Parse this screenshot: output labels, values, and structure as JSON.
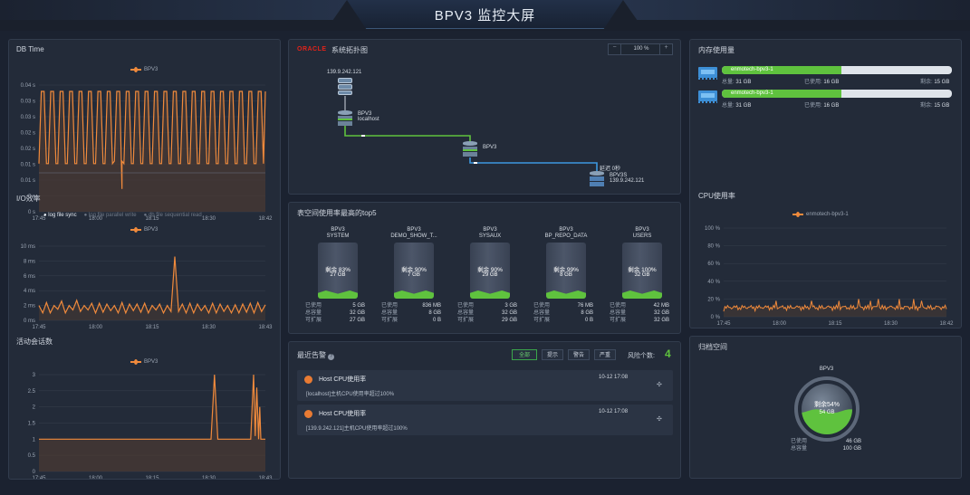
{
  "header": {
    "title": "BPV3 监控大屏"
  },
  "db_time": {
    "title": "DB Time",
    "legend": "BPV3",
    "y_ticks": [
      "0.04 s",
      "0.03 s",
      "0.03 s",
      "0.02 s",
      "0.02 s",
      "0.01 s",
      "0.01 s",
      "0 s",
      "0 s"
    ],
    "x_ticks": [
      "17:45",
      "18:00",
      "18:15",
      "18:30",
      "18:42"
    ]
  },
  "io": {
    "title": "I/O效率",
    "options": [
      "log file sync",
      "log file parallel write",
      "db file sequential read"
    ],
    "legend": "BPV3",
    "y_ticks": [
      "10 ms",
      "8 ms",
      "6 ms",
      "4 ms",
      "2 ms",
      "0 ms"
    ],
    "x_ticks": [
      "17:45",
      "18:00",
      "18:15",
      "18:30",
      "18:43"
    ]
  },
  "sessions": {
    "title": "活动会话数",
    "legend": "BPV3",
    "y_ticks": [
      "3",
      "2.5",
      "2",
      "1.5",
      "1",
      "0.5",
      "0"
    ],
    "x_ticks": [
      "17:45",
      "18:00",
      "18:15",
      "18:30",
      "18:43"
    ]
  },
  "topology": {
    "brand": "ORACLE",
    "title": "系统拓扑图",
    "zoom": "100 %",
    "nodes": {
      "top_ip": "139.9.242.121",
      "local_name": "BPV3",
      "local_host": "localhost",
      "center": "BPV3",
      "remote_status": "延迟 0秒",
      "remote_name": "BPV3S",
      "remote_ip": "139.9.242.121"
    }
  },
  "tablespace": {
    "title": "表空间使用率最高的top5",
    "items": [
      {
        "name": "BPV3",
        "sub": "SYSTEM",
        "pct": "剩余 83%",
        "free": "27 GB",
        "used": "5 GB",
        "total": "32 GB",
        "ext": "27 GB"
      },
      {
        "name": "BPV3",
        "sub": "DEMO_SHOW_T...",
        "pct": "剩余 90%",
        "free": "7 GB",
        "used": "836 MB",
        "total": "8 GB",
        "ext": "0 B"
      },
      {
        "name": "BPV3",
        "sub": "SYSAUX",
        "pct": "剩余 90%",
        "free": "29 GB",
        "used": "3 GB",
        "total": "32 GB",
        "ext": "29 GB"
      },
      {
        "name": "BPV3",
        "sub": "BP_REPO_DATA",
        "pct": "剩余 99%",
        "free": "8 GB",
        "used": "76 MB",
        "total": "8 GB",
        "ext": "0 B"
      },
      {
        "name": "BPV3",
        "sub": "USERS",
        "pct": "剩余 100%",
        "free": "32 GB",
        "used": "42 MB",
        "total": "32 GB",
        "ext": "32 GB"
      }
    ],
    "stat_labels": [
      "已使用",
      "总容量",
      "可扩展"
    ]
  },
  "alerts": {
    "title": "最近告警",
    "filters": [
      "全部",
      "提示",
      "警告",
      "严重"
    ],
    "count_label": "风险个数:",
    "count": "4",
    "items": [
      {
        "title": "Host CPU使用率",
        "desc": "[localhost]主机CPU使用率超过100%",
        "time": "10-12 17:08"
      },
      {
        "title": "Host CPU使用率",
        "desc": "[139.9.242.121]主机CPU使用率超过100%",
        "time": "10-12 17:08"
      }
    ]
  },
  "memory": {
    "title": "内存使用量",
    "rows": [
      {
        "host": "enmotech-bpv3-1",
        "total_label": "总量:",
        "total": "31 GB",
        "used_label": "已使用:",
        "used": "16 GB",
        "free_label": "剩余:",
        "free": "15 GB",
        "usage": 0.52
      },
      {
        "host": "enmotech-bpv3-1",
        "total_label": "总量:",
        "total": "31 GB",
        "used_label": "已使用:",
        "used": "16 GB",
        "free_label": "剩余:",
        "free": "15 GB",
        "usage": 0.52
      }
    ]
  },
  "cpu": {
    "title": "CPU使用率",
    "legend": "enmotech-bpv3-1",
    "y_ticks": [
      "100 %",
      "80 %",
      "60 %",
      "40 %",
      "20 %",
      "0 %"
    ],
    "x_ticks": [
      "17:45",
      "18:00",
      "18:15",
      "18:30",
      "18:42"
    ]
  },
  "archive": {
    "title": "归档空间",
    "name": "BPV3",
    "pct": "剩余54%",
    "free": "54 GB",
    "used_label": "已使用",
    "used": "46 GB",
    "total_label": "总容量",
    "total": "100 GB",
    "usage": 0.46
  },
  "colors": {
    "accent": "#f08a3c",
    "green": "#5fc23e",
    "panel": "#232b39",
    "bg": "#1b2230"
  }
}
